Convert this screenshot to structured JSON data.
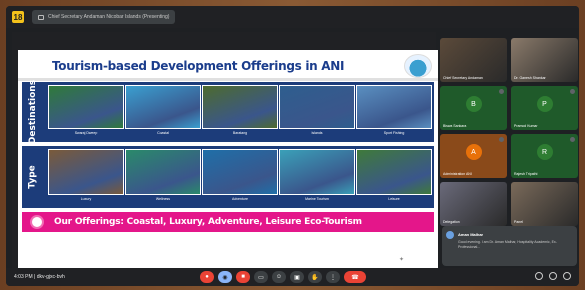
{
  "window": {
    "app_icon_label": "18",
    "meeting_title": "Chief Secretary Andaman Nicobar Islands (Presenting)"
  },
  "slide": {
    "title": "Tourism-based Development Offerings in ANI",
    "rows": [
      {
        "label": "Destinations",
        "tiles": [
          {
            "caption": "Swaraj Dweep",
            "color": "#2f7a3a"
          },
          {
            "caption": "Coastal",
            "color": "#3a9fd0"
          },
          {
            "caption": "Baratang",
            "color": "#4d6b2e"
          },
          {
            "caption": "Islands",
            "color": "#2e5e8e"
          },
          {
            "caption": "Sport Fishing",
            "color": "#5a8fc0"
          }
        ]
      },
      {
        "label": "Type",
        "tiles": [
          {
            "caption": "Luxury",
            "color": "#7a5a3a"
          },
          {
            "caption": "Wellness",
            "color": "#2a8a6a"
          },
          {
            "caption": "Adventure",
            "color": "#1f6fa8"
          },
          {
            "caption": "Marine Tourism",
            "color": "#3aa0b8"
          },
          {
            "caption": "Leisure",
            "color": "#3f7a3a"
          }
        ]
      }
    ],
    "offer_text": "Our Offerings: Coastal, Luxury, Adventure, Leisure Eco-Tourism"
  },
  "participants": [
    {
      "name": "Chief Secretary Andaman",
      "type": "video",
      "color": "#5b4a3a",
      "initial": ""
    },
    {
      "name": "Dr. Ganesh Shankar",
      "type": "video",
      "color": "#8a7a6a",
      "initial": ""
    },
    {
      "name": "Biswa Sankara",
      "type": "avatar",
      "color": "#2e7d32",
      "initial": "B"
    },
    {
      "name": "Pramod Kumar",
      "type": "avatar",
      "color": "#2e7d32",
      "initial": "P"
    },
    {
      "name": "Administration ANI",
      "type": "avatar",
      "color": "#e8710a",
      "initial": "A"
    },
    {
      "name": "Rajesh Tripathi",
      "type": "avatar",
      "color": "#2e7d32",
      "initial": "R"
    },
    {
      "name": "Delegation",
      "type": "video",
      "color": "#6a6a7a",
      "initial": ""
    },
    {
      "name": "Panel",
      "type": "video",
      "color": "#7a6a5a",
      "initial": ""
    }
  ],
  "chat": {
    "sender": "Aman Malhar",
    "message": "Good evening. I am Dr. Aman Malhar, Hospitality Academic, Ex-Professional..."
  },
  "bottom": {
    "time": "4:03 PM",
    "meeting_code": "dkv-gjxc-bvh",
    "controls": [
      "mic-off",
      "camera-off",
      "captions",
      "emoji",
      "present",
      "raise-hand",
      "more",
      "end-call"
    ]
  }
}
